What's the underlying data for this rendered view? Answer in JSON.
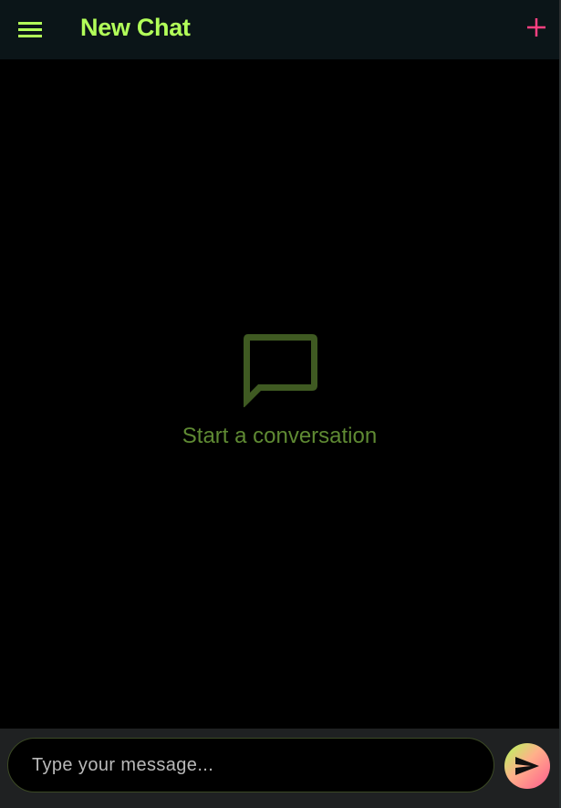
{
  "app_bar": {
    "title": "New Chat",
    "menu_icon": "menu-icon",
    "new_chat_icon": "plus-icon"
  },
  "empty_state": {
    "icon": "chat-bubble-icon",
    "text": "Start a conversation"
  },
  "composer": {
    "placeholder": "Type your message...",
    "value": "",
    "send_icon": "send-icon"
  },
  "colors": {
    "accent_green": "#b2ff59",
    "accent_pink": "#ff4081",
    "muted_green": "#5f8a33",
    "app_bar_bg": "#0b1518",
    "composer_bg": "#1f2122"
  }
}
